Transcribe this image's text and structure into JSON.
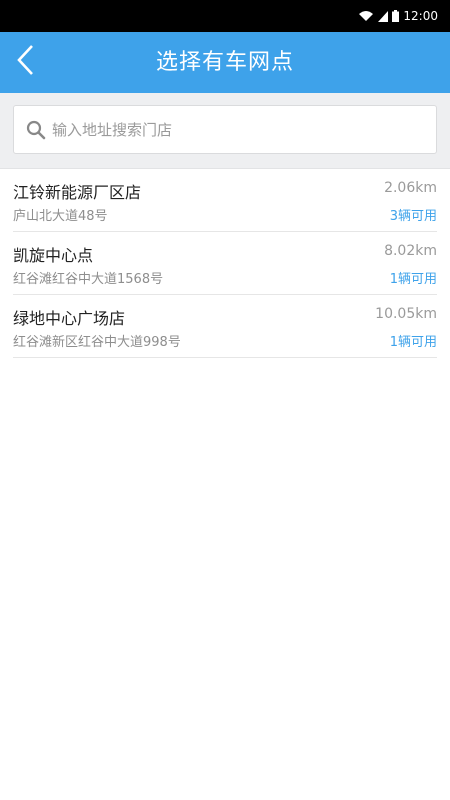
{
  "status_bar": {
    "time": "12:00"
  },
  "header": {
    "title": "选择有车网点",
    "back_icon": "chevron-left-icon"
  },
  "search": {
    "placeholder": "输入地址搜索门店",
    "value": "",
    "icon": "search-icon"
  },
  "stores": [
    {
      "name": "江铃新能源厂区店",
      "address": "庐山北大道48号",
      "distance": "2.06km",
      "available": "3辆可用"
    },
    {
      "name": "凯旋中心点",
      "address": "红谷滩红谷中大道1568号",
      "distance": "8.02km",
      "available": "1辆可用"
    },
    {
      "name": "绿地中心广场店",
      "address": "红谷滩新区红谷中大道998号",
      "distance": "10.05km",
      "available": "1辆可用"
    }
  ],
  "colors": {
    "accent": "#3ea2ea",
    "status_bar": "#000000",
    "search_background": "#eeeff1"
  }
}
